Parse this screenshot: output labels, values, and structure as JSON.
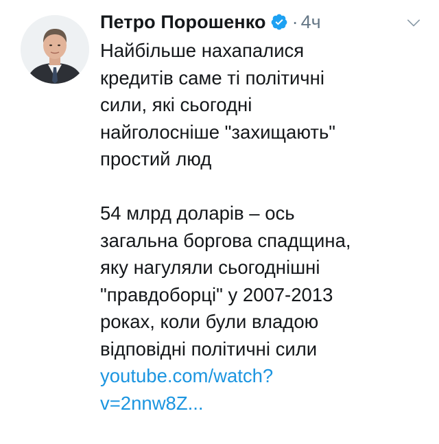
{
  "tweet": {
    "author_name": "Петро Порошенко",
    "separator": "·",
    "timestamp": "4ч",
    "paragraph1": [
      "Найбільше нахапалися",
      "кредитів саме ті політичні",
      "сили, які сьогодні",
      "найголосніше \"захищають\"",
      "простий люд"
    ],
    "paragraph2": [
      "54 млрд доларів – ось",
      "загальна боргова спадщина,",
      "яку нагуляли сьогоднішні",
      "\"правдоборці\" у 2007-2013",
      "роках, коли були владою",
      "відповідні політичні сили"
    ],
    "link_lines": [
      "youtube.com/watch?",
      "v=2nnw8Z..."
    ]
  },
  "icons": {
    "avatar": "profile-photo",
    "verified": "verified-badge-icon",
    "menu": "chevron-down-icon"
  },
  "colors": {
    "text": "#14171a",
    "muted": "#657786",
    "link": "#1b95e0",
    "verified": "#1da1f2"
  }
}
